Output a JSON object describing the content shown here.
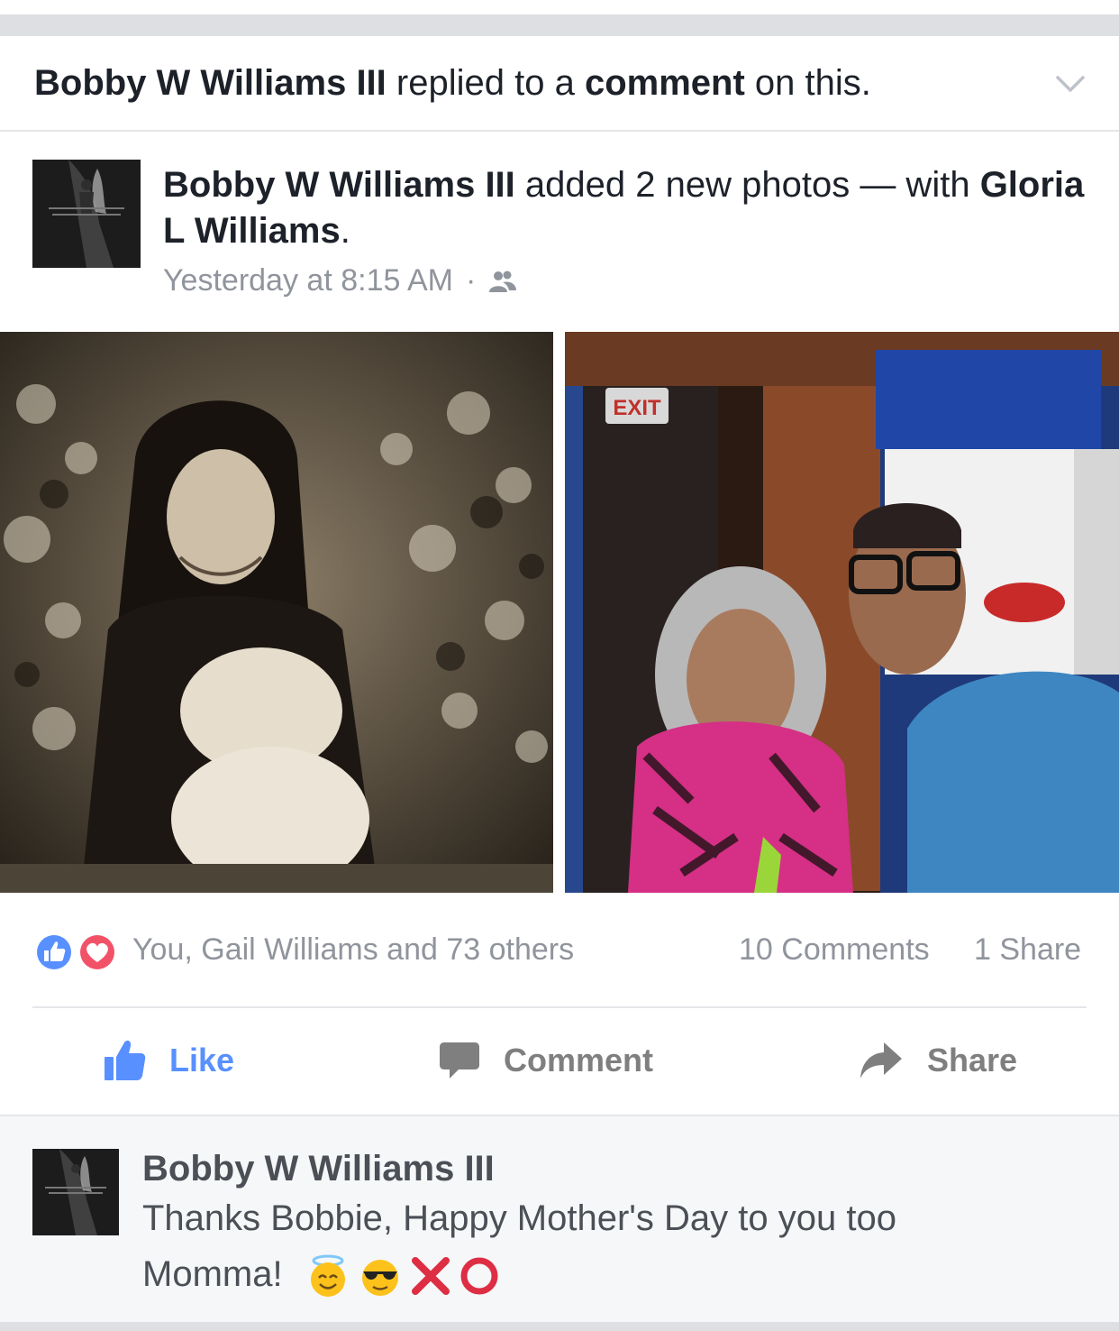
{
  "story": {
    "actor": "Bobby W Williams III",
    "action": "replied to a",
    "object": "comment",
    "suffix": "on this.",
    "menu_icon": "chevron-down-icon"
  },
  "post": {
    "author": "Bobby W Williams III",
    "action": "added 2 new photos — with",
    "tagged": "Gloria L Williams",
    "title_suffix": ".",
    "timestamp": "Yesterday at 8:15 AM",
    "separator": "·",
    "privacy_icon": "friends-icon",
    "photos": [
      {
        "description": "vintage sepia photo of a woman holding a baby in front of foliage"
      },
      {
        "description": "older couple seated together in a restaurant with an exit sign"
      }
    ]
  },
  "reactions": {
    "icons": [
      "like-reaction-icon",
      "love-reaction-icon"
    ],
    "summary": "You, Gail Williams and 73 others",
    "comments": "10 Comments",
    "shares": "1 Share"
  },
  "actions": {
    "like": "Like",
    "comment": "Comment",
    "share": "Share"
  },
  "comment": {
    "author": "Bobby W Williams III",
    "text_line1": "Thanks Bobbie, Happy Mother's Day to you too",
    "text_line2": "Momma!",
    "emojis": [
      "angel-emoji-icon",
      "sunglasses-emoji-icon",
      "cross-mark-icon",
      "circle-mark-icon"
    ]
  },
  "colors": {
    "like_blue": "#5890ff",
    "love_red": "#f25268",
    "meta_gray": "#90949c",
    "divider": "#e5e6e9"
  }
}
